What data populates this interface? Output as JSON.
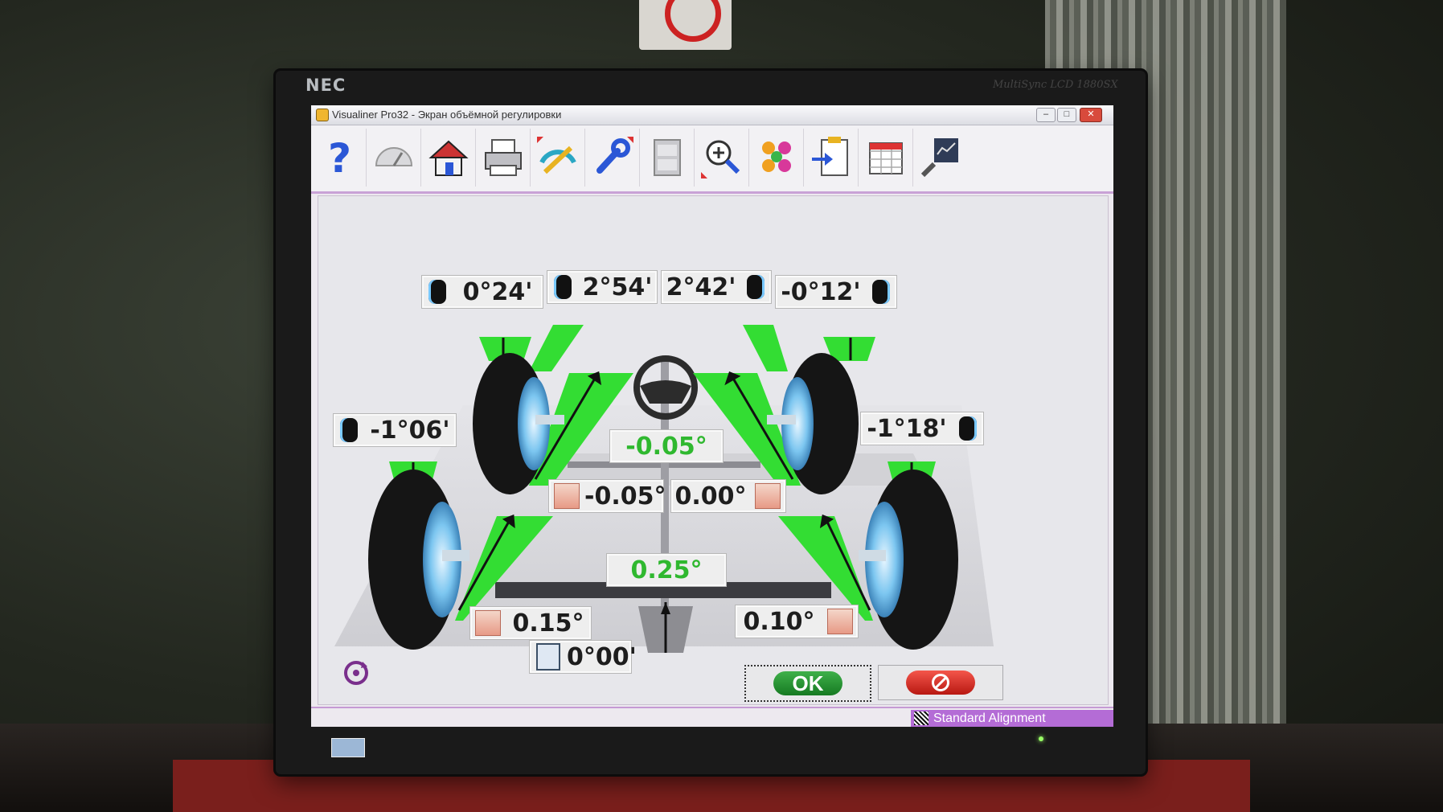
{
  "monitor": {
    "brand": "NEC",
    "model": "MultiSync LCD 1880SX"
  },
  "window": {
    "title": "Visualiner Pro32  -  Экран объёмной регулировки",
    "controls": {
      "minimize": "–",
      "maximize": "□",
      "close": "✕"
    }
  },
  "toolbar": {
    "items": [
      {
        "icon": "help-icon"
      },
      {
        "icon": "gauge-icon"
      },
      {
        "icon": "home-icon"
      },
      {
        "icon": "printer-icon"
      },
      {
        "icon": "measure-icon"
      },
      {
        "icon": "wrench-icon"
      },
      {
        "icon": "film-icon"
      },
      {
        "icon": "zoom-icon"
      },
      {
        "icon": "chart-pattern-icon"
      },
      {
        "icon": "clipboard-import-icon"
      },
      {
        "icon": "spreadsheet-icon"
      },
      {
        "icon": "specs-tool-icon"
      }
    ]
  },
  "readings": {
    "front_left_camber": "0°24'",
    "front_left_caster": "2°54'",
    "front_right_caster": "2°42'",
    "front_right_camber": "-0°12'",
    "rear_left_camber": "-1°06'",
    "rear_right_camber": "-1°18'",
    "steering_wheel": "-0.05°",
    "front_left_toe": "-0.05°",
    "front_right_toe": "0.00°",
    "rear_total_toe": "0.25°",
    "rear_left_toe": "0.15°",
    "rear_right_toe": "0.10°",
    "thrust_angle": "0°00'"
  },
  "buttons": {
    "ok_label": "OK"
  },
  "status": {
    "mode": "Standard Alignment"
  },
  "colors": {
    "in_spec": "#2fb82f",
    "accent": "#b46cd6",
    "ok": "#1f8f2a",
    "cancel": "#d8261e"
  }
}
